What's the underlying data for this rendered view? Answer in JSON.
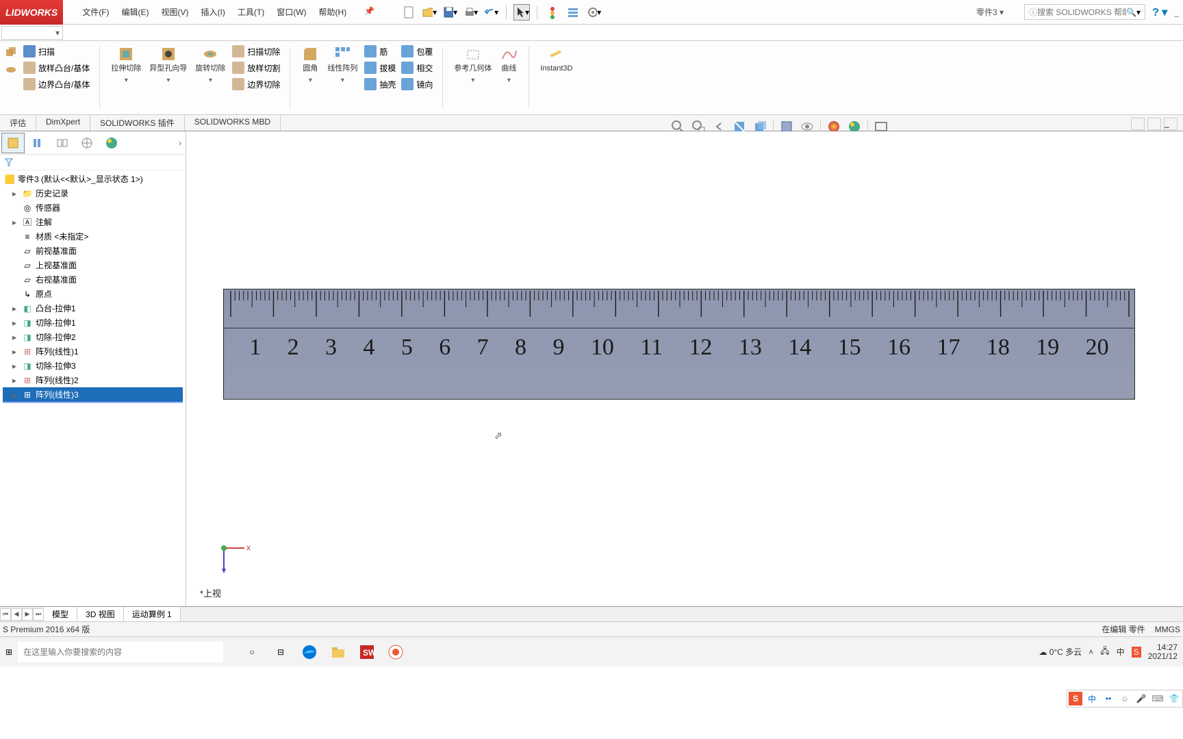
{
  "app": {
    "logo": "LIDWORKS",
    "doc_title": "零件3",
    "search_placeholder": "搜索 SOLIDWORKS 帮助"
  },
  "menu": {
    "file": "文件(F)",
    "edit": "编辑(E)",
    "view": "视图(V)",
    "insert": "插入(I)",
    "tools": "工具(T)",
    "window": "窗口(W)",
    "help": "帮助(H)"
  },
  "ribbon": {
    "sweep": "扫描",
    "loft": "放样凸台/基体",
    "boundary": "边界凸台/基体",
    "ext_cut": "拉伸切除",
    "hole": "异型孔向导",
    "rev_cut": "旋转切除",
    "sweep_cut": "扫描切除",
    "loft_cut": "放样切割",
    "boundary_cut": "边界切除",
    "fillet": "圆角",
    "pattern": "线性阵列",
    "rib": "筋",
    "draft": "拔模",
    "shell": "抽壳",
    "wrap": "包覆",
    "intersect": "相交",
    "mirror": "镜向",
    "ref_geom": "参考几何体",
    "curves": "曲线",
    "instant3d": "Instant3D"
  },
  "tabs": {
    "eval": "评估",
    "dimxpert": "DimXpert",
    "addins": "SOLIDWORKS 插件",
    "mbd": "SOLIDWORKS MBD"
  },
  "tree": {
    "root": "零件3 (默认<<默认>_显示状态 1>)",
    "history": "历史记录",
    "sensors": "传感器",
    "annotations": "注解",
    "material": "材质 <未指定>",
    "front": "前视基准面",
    "top": "上视基准面",
    "right": "右视基准面",
    "origin": "原点",
    "f1": "凸台-拉伸1",
    "f2": "切除-拉伸1",
    "f3": "切除-拉伸2",
    "f4": "阵列(线性)1",
    "f5": "切除-拉伸3",
    "f6": "阵列(线性)2",
    "f7": "阵列(线性)3"
  },
  "ruler": {
    "numbers": [
      "1",
      "2",
      "3",
      "4",
      "5",
      "6",
      "7",
      "8",
      "9",
      "10",
      "11",
      "12",
      "13",
      "14",
      "15",
      "16",
      "17",
      "18",
      "19",
      "20"
    ]
  },
  "view_label": "*上视",
  "bottom_tabs": {
    "model": "模型",
    "view3d": "3D 视图",
    "motion": "运动算例 1"
  },
  "status": {
    "version": "S Premium 2016 x64 版",
    "mode": "在编辑 零件",
    "units": "MMGS"
  },
  "taskbar": {
    "search_placeholder": "在这里输入你要搜索的内容",
    "weather": "0°C 多云",
    "time": "14:27",
    "date": "2021/12"
  }
}
